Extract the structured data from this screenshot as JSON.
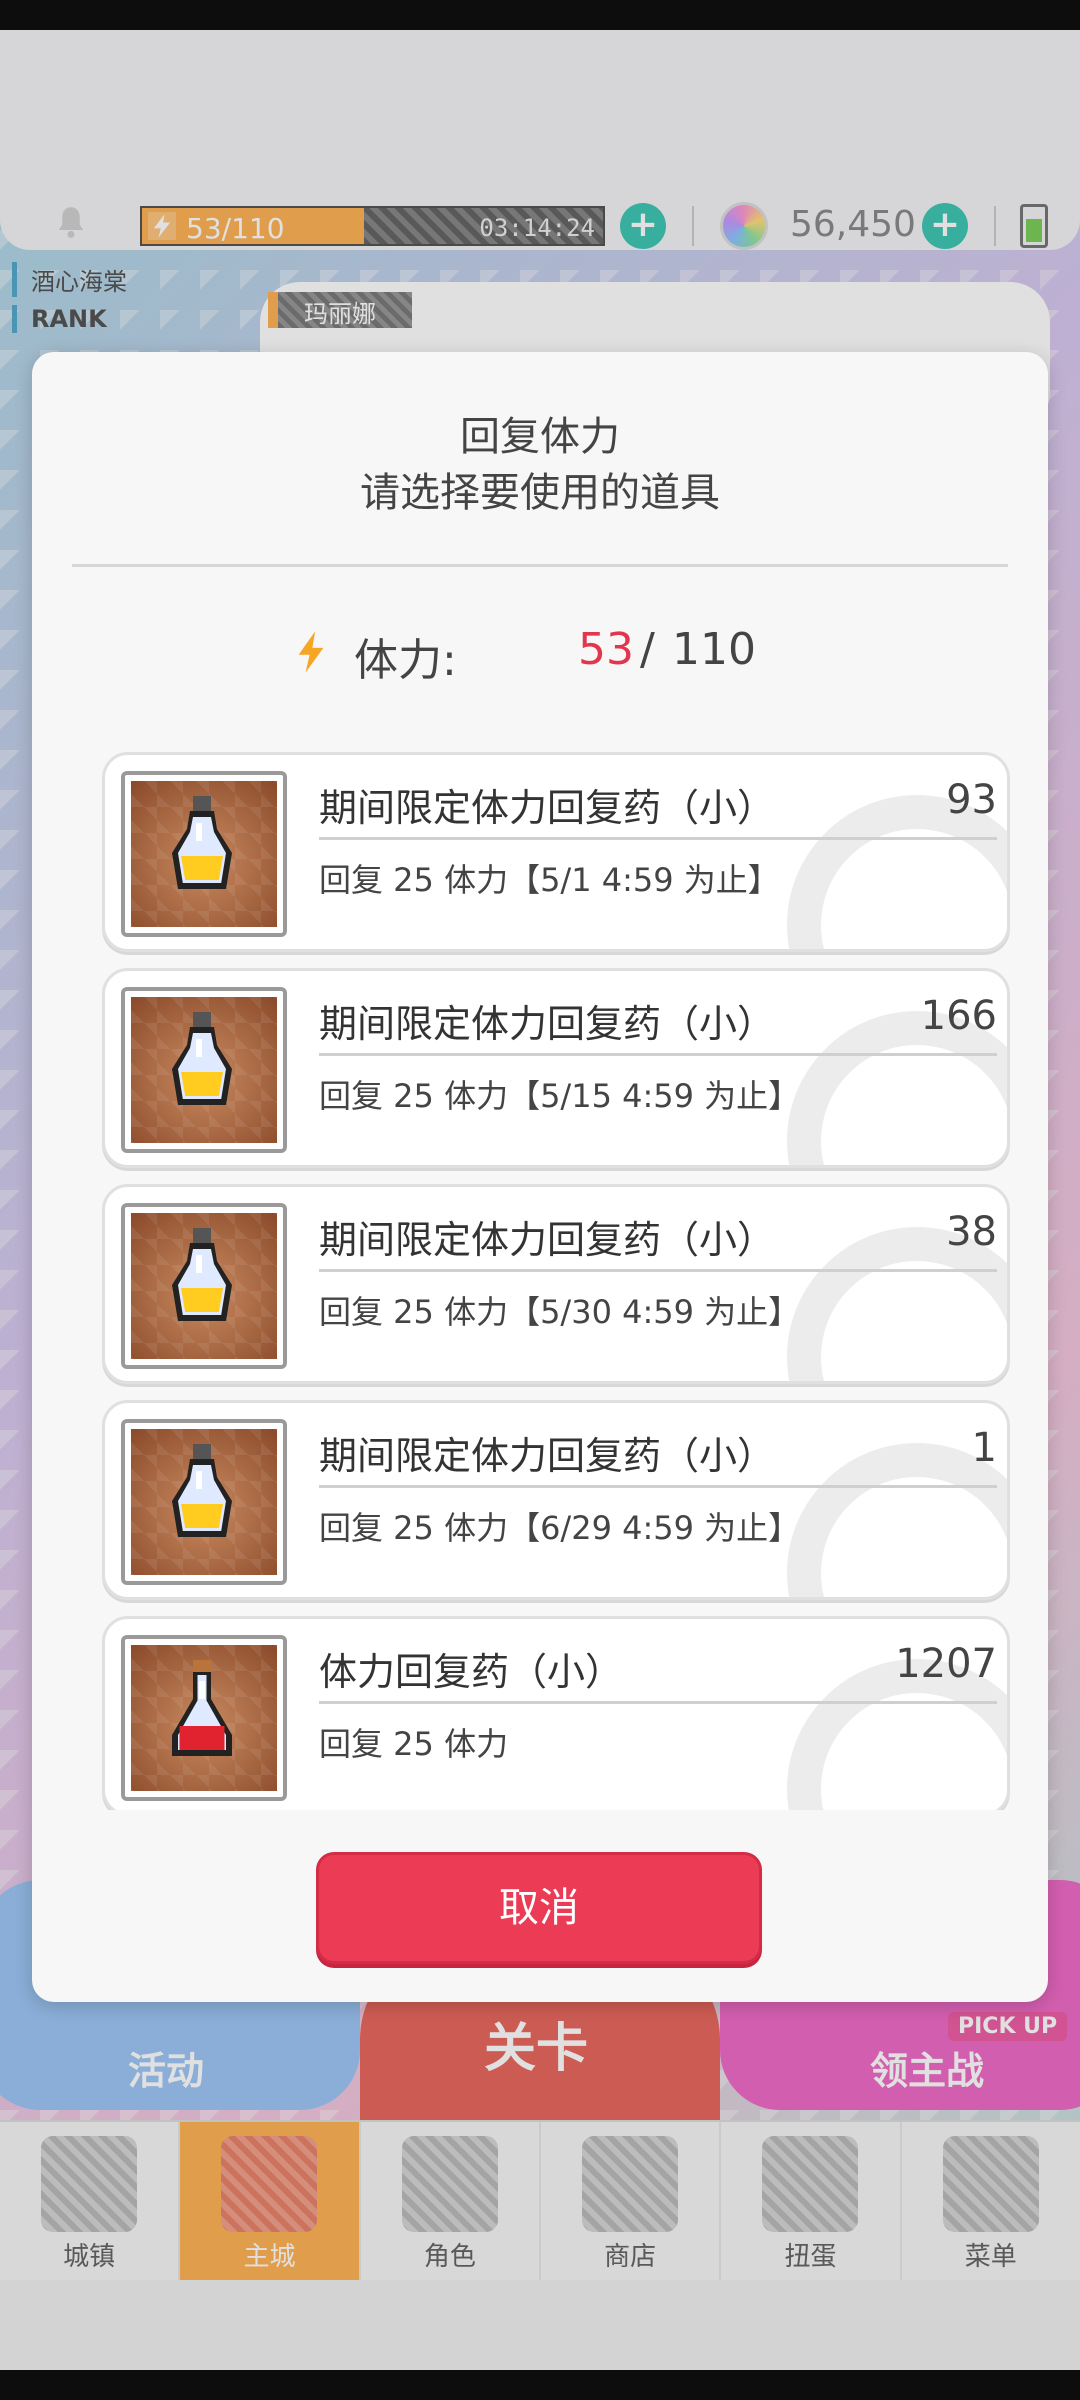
{
  "hud": {
    "stamina_text": "53/110",
    "stamina_fraction": 0.4818,
    "stamina_timer": "03:14:24",
    "gems": "56,450"
  },
  "background": {
    "player_name": "酒心海棠",
    "rank_label": "RANK",
    "character_name": "玛丽娜"
  },
  "game_buttons": {
    "event": "活动",
    "stage": "关卡",
    "boss": "领主战",
    "pickup": "PICK UP"
  },
  "nav": [
    {
      "label": "城镇",
      "icon": "town-icon"
    },
    {
      "label": "主城",
      "icon": "main-city-icon"
    },
    {
      "label": "角色",
      "icon": "character-icon"
    },
    {
      "label": "商店",
      "icon": "shop-icon"
    },
    {
      "label": "扭蛋",
      "icon": "gacha-icon"
    },
    {
      "label": "菜单",
      "icon": "menu-icon"
    }
  ],
  "dialog": {
    "title": "回复体力",
    "subtitle": "请选择要使用的道具",
    "stamina_label": "体力:",
    "stamina_current": "53",
    "stamina_sep": "/",
    "stamina_max": "110",
    "items": [
      {
        "name": "期间限定体力回复药（小）",
        "qty": "93",
        "desc": "回复 25 体力【5/1 4:59 为止】",
        "potion": "yellow"
      },
      {
        "name": "期间限定体力回复药（小）",
        "qty": "166",
        "desc": "回复 25 体力【5/15 4:59 为止】",
        "potion": "yellow"
      },
      {
        "name": "期间限定体力回复药（小）",
        "qty": "38",
        "desc": "回复 25 体力【5/30 4:59 为止】",
        "potion": "yellow"
      },
      {
        "name": "期间限定体力回复药（小）",
        "qty": "1",
        "desc": "回复 25 体力【6/29 4:59 为止】",
        "potion": "yellow"
      },
      {
        "name": "体力回复药（小）",
        "qty": "1207",
        "desc": "回复 25 体力",
        "potion": "red"
      }
    ],
    "cancel_label": "取消"
  },
  "colors": {
    "accent_red": "#eb3b55",
    "stamina_orange": "#ffb457",
    "teal_plus": "#3fc6b4"
  }
}
